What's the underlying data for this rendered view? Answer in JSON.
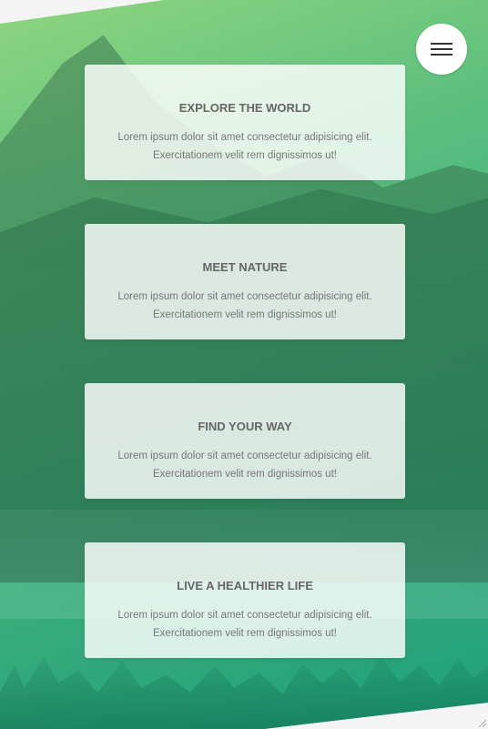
{
  "menu": {
    "icon": "hamburger-icon"
  },
  "cards": [
    {
      "title": "EXPLORE THE WORLD",
      "text_line1": "Lorem ipsum dolor sit amet consectetur adipisicing elit.",
      "text_line2": "Exercitationem velit rem dignissimos ut!"
    },
    {
      "title": "MEET NATURE",
      "text_line1": "Lorem ipsum dolor sit amet consectetur adipisicing elit.",
      "text_line2": "Exercitationem velit rem dignissimos ut!"
    },
    {
      "title": "FIND YOUR WAY",
      "text_line1": "Lorem ipsum dolor sit amet consectetur adipisicing elit.",
      "text_line2": "Exercitationem velit rem dignissimos ut!"
    },
    {
      "title": "LIVE A HEALTHIER LIFE",
      "text_line1": "Lorem ipsum dolor sit amet consectetur adipisicing elit.",
      "text_line2": "Exercitationem velit rem dignissimos ut!"
    }
  ],
  "colors": {
    "gradient_start": "#8fd57f",
    "gradient_end": "#1fa07b",
    "card_bg": "#ffffff"
  }
}
